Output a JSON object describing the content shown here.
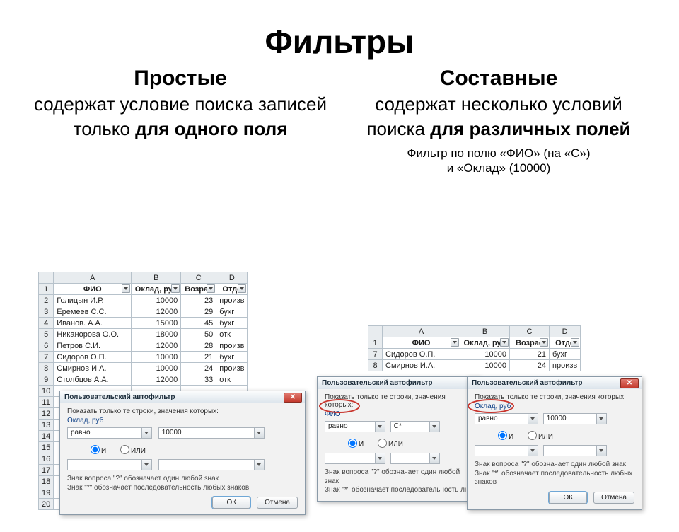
{
  "title": "Фильтры",
  "left": {
    "heading": "Простые",
    "desc_pre": "содержат условие поиска записей только ",
    "desc_bold": "для одного поля"
  },
  "right": {
    "heading": "Составные",
    "desc_pre": "содержат несколько условий поиска ",
    "desc_bold": "для различных полей",
    "filter_caption_l1": "Фильтр по полю «ФИО» (на «С»)",
    "filter_caption_l2": "и «Оклад» (10000)"
  },
  "grid1": {
    "col_letters": [
      "A",
      "B",
      "C",
      "D"
    ],
    "headers": [
      "ФИО",
      "Оклад, руб",
      "Возрас",
      "Отде"
    ],
    "rows": [
      {
        "n": "2",
        "fio": "Голицын И.Р.",
        "ok": "10000",
        "age": "23",
        "dep": "произв"
      },
      {
        "n": "3",
        "fio": "Еремеев С.С.",
        "ok": "12000",
        "age": "29",
        "dep": "бухг"
      },
      {
        "n": "4",
        "fio": "Иванов. А.А.",
        "ok": "15000",
        "age": "45",
        "dep": "бухг"
      },
      {
        "n": "5",
        "fio": "Никанорова О.О.",
        "ok": "18000",
        "age": "50",
        "dep": "отк"
      },
      {
        "n": "6",
        "fio": "Петров С.И.",
        "ok": "12000",
        "age": "28",
        "dep": "произв"
      },
      {
        "n": "7",
        "fio": "Сидоров О.П.",
        "ok": "10000",
        "age": "21",
        "dep": "бухг"
      },
      {
        "n": "8",
        "fio": "Смирнов И.А.",
        "ok": "10000",
        "age": "24",
        "dep": "произв"
      },
      {
        "n": "9",
        "fio": "Столбцов А.А.",
        "ok": "12000",
        "age": "33",
        "dep": "отк"
      }
    ],
    "extra_rows": [
      "10",
      "11",
      "12",
      "13",
      "14",
      "15",
      "16",
      "17",
      "18",
      "19",
      "20"
    ]
  },
  "grid2": {
    "col_letters": [
      "A",
      "B",
      "C",
      "D"
    ],
    "headers": [
      "ФИО",
      "Оклад, руб",
      "Возрас",
      "Отде"
    ],
    "rows": [
      {
        "n": "7",
        "fio": "Сидоров О.П.",
        "ok": "10000",
        "age": "21",
        "dep": "бухг"
      },
      {
        "n": "8",
        "fio": "Смирнов И.А.",
        "ok": "10000",
        "age": "24",
        "dep": "произв"
      }
    ]
  },
  "dialog": {
    "title": "Пользовательский автофильтр",
    "instr": "Показать только те строки, значения которых:",
    "field_oklad": "Оклад, руб",
    "field_fio": "ФИО",
    "op_equals": "равно",
    "val_10000": "10000",
    "val_cstar": "С*",
    "radio_and": "И",
    "radio_or": "ИЛИ",
    "hint1": "Знак вопроса \"?\" обозначает один любой знак",
    "hint2": "Знак \"*\" обозначает последовательность любых знаков",
    "ok": "ОК",
    "cancel": "Отмена"
  }
}
